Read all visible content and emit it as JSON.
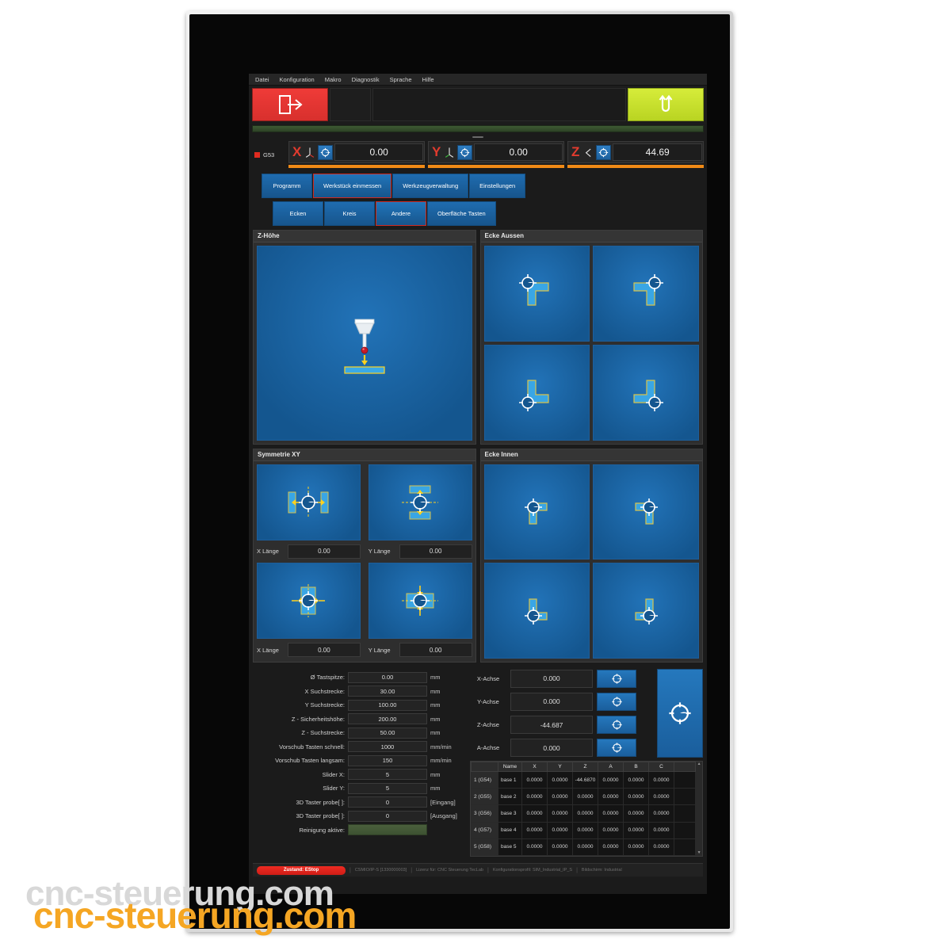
{
  "menubar": {
    "items": [
      "Datei",
      "Konfiguration",
      "Makro",
      "Diagnostik",
      "Sprache",
      "Hilfe"
    ]
  },
  "toolbar": {
    "exit_icon": "exit-door-icon",
    "reset_icon": "reset-loop-icon",
    "exit_label": "",
    "reset_label": ""
  },
  "dro": {
    "coordinate_system": "G53",
    "axes": [
      {
        "letter": "X",
        "value": "0.00"
      },
      {
        "letter": "Y",
        "value": "0.00"
      },
      {
        "letter": "Z",
        "value": "44.69"
      }
    ]
  },
  "main_tabs": [
    {
      "label": "Programm",
      "selected": false
    },
    {
      "label": "Werkstück einmessen",
      "selected": true
    },
    {
      "label": "Werkzeugverwaltung",
      "selected": false
    },
    {
      "label": "Einstellungen",
      "selected": false
    }
  ],
  "sub_tabs": [
    {
      "label": "Ecken",
      "selected": false
    },
    {
      "label": "Kreis",
      "selected": false
    },
    {
      "label": "Andere",
      "selected": true
    },
    {
      "label": "Oberfläche Tasten",
      "selected": false
    }
  ],
  "panels": {
    "z_height": {
      "title": "Z-Höhe"
    },
    "outer_corner": {
      "title": "Ecke Aussen"
    },
    "symmetry": {
      "title": "Symmetrie XY",
      "fields": [
        {
          "label": "X Länge",
          "value": "0.00"
        },
        {
          "label": "Y Länge",
          "value": "0.00"
        },
        {
          "label": "X Länge",
          "value": "0.00"
        },
        {
          "label": "Y Länge",
          "value": "0.00"
        }
      ]
    },
    "inner_corner": {
      "title": "Ecke Innen"
    }
  },
  "settings": [
    {
      "label": "Ø Tastspitze:",
      "value": "0.00",
      "unit": "mm"
    },
    {
      "label": "X Suchstrecke:",
      "value": "30.00",
      "unit": "mm"
    },
    {
      "label": "Y Suchstrecke:",
      "value": "100.00",
      "unit": "mm"
    },
    {
      "label": "Z - Sicherheitshöhe:",
      "value": "200.00",
      "unit": "mm"
    },
    {
      "label": "Z - Suchstrecke:",
      "value": "50.00",
      "unit": "mm"
    },
    {
      "label": "Vorschub Tasten schnell:",
      "value": "1000",
      "unit": "mm/min"
    },
    {
      "label": "Vorschub Tasten langsam:",
      "value": "150",
      "unit": "mm/min"
    },
    {
      "label": "Slider X:",
      "value": "5",
      "unit": "mm"
    },
    {
      "label": "Slider Y:",
      "value": "5",
      "unit": "mm"
    },
    {
      "label": "3D Taster probe[ ]:",
      "value": "0",
      "unit": "[Eingang]"
    },
    {
      "label": "3D Taster probe[ ]:",
      "value": "0",
      "unit": "[Ausgang]"
    },
    {
      "label": "Reinigung aktive:",
      "value": "",
      "unit": ""
    }
  ],
  "axis_offsets": [
    {
      "label": "X-Achse",
      "value": "0.000"
    },
    {
      "label": "Y-Achse",
      "value": "0.000"
    },
    {
      "label": "Z-Achse",
      "value": "-44.687"
    },
    {
      "label": "A-Achse",
      "value": "0.000"
    }
  ],
  "offset_table": {
    "headers": [
      "",
      "Name",
      "X",
      "Y",
      "Z",
      "A",
      "B",
      "C"
    ],
    "rows": [
      {
        "id": "1 (G54)",
        "name": "base 1",
        "x": "0.0000",
        "y": "0.0000",
        "z": "-44.6870",
        "a": "0.0000",
        "b": "0.0000",
        "c": "0.0000"
      },
      {
        "id": "2 (G55)",
        "name": "base 2",
        "x": "0.0000",
        "y": "0.0000",
        "z": "0.0000",
        "a": "0.0000",
        "b": "0.0000",
        "c": "0.0000"
      },
      {
        "id": "3 (G56)",
        "name": "base 3",
        "x": "0.0000",
        "y": "0.0000",
        "z": "0.0000",
        "a": "0.0000",
        "b": "0.0000",
        "c": "0.0000"
      },
      {
        "id": "4 (G57)",
        "name": "base 4",
        "x": "0.0000",
        "y": "0.0000",
        "z": "0.0000",
        "a": "0.0000",
        "b": "0.0000",
        "c": "0.0000"
      },
      {
        "id": "5 (G58)",
        "name": "base 5",
        "x": "0.0000",
        "y": "0.0000",
        "z": "0.0000",
        "a": "0.0000",
        "b": "0.0000",
        "c": "0.0000"
      }
    ]
  },
  "statusbar": {
    "state": "Zustand: EStop",
    "device": "CSMIO/IP-S [1330000003]",
    "license": "Lizenz für: CNC Steuerung TecLab",
    "profile": "Konfigurationsprofil: SIM_Industrial_IP_S",
    "vendor": "Bildschirm: Industrial"
  },
  "watermark": {
    "text": "cnc-steuerung.com"
  },
  "colors": {
    "accent_blue": "#1f6cb0",
    "exit_red": "#ef3b38",
    "reset_green": "#d6ec3a",
    "dro_orange": "#f08a16",
    "estop_red": "#ee2b22",
    "watermark_orange": "#f5a623"
  }
}
